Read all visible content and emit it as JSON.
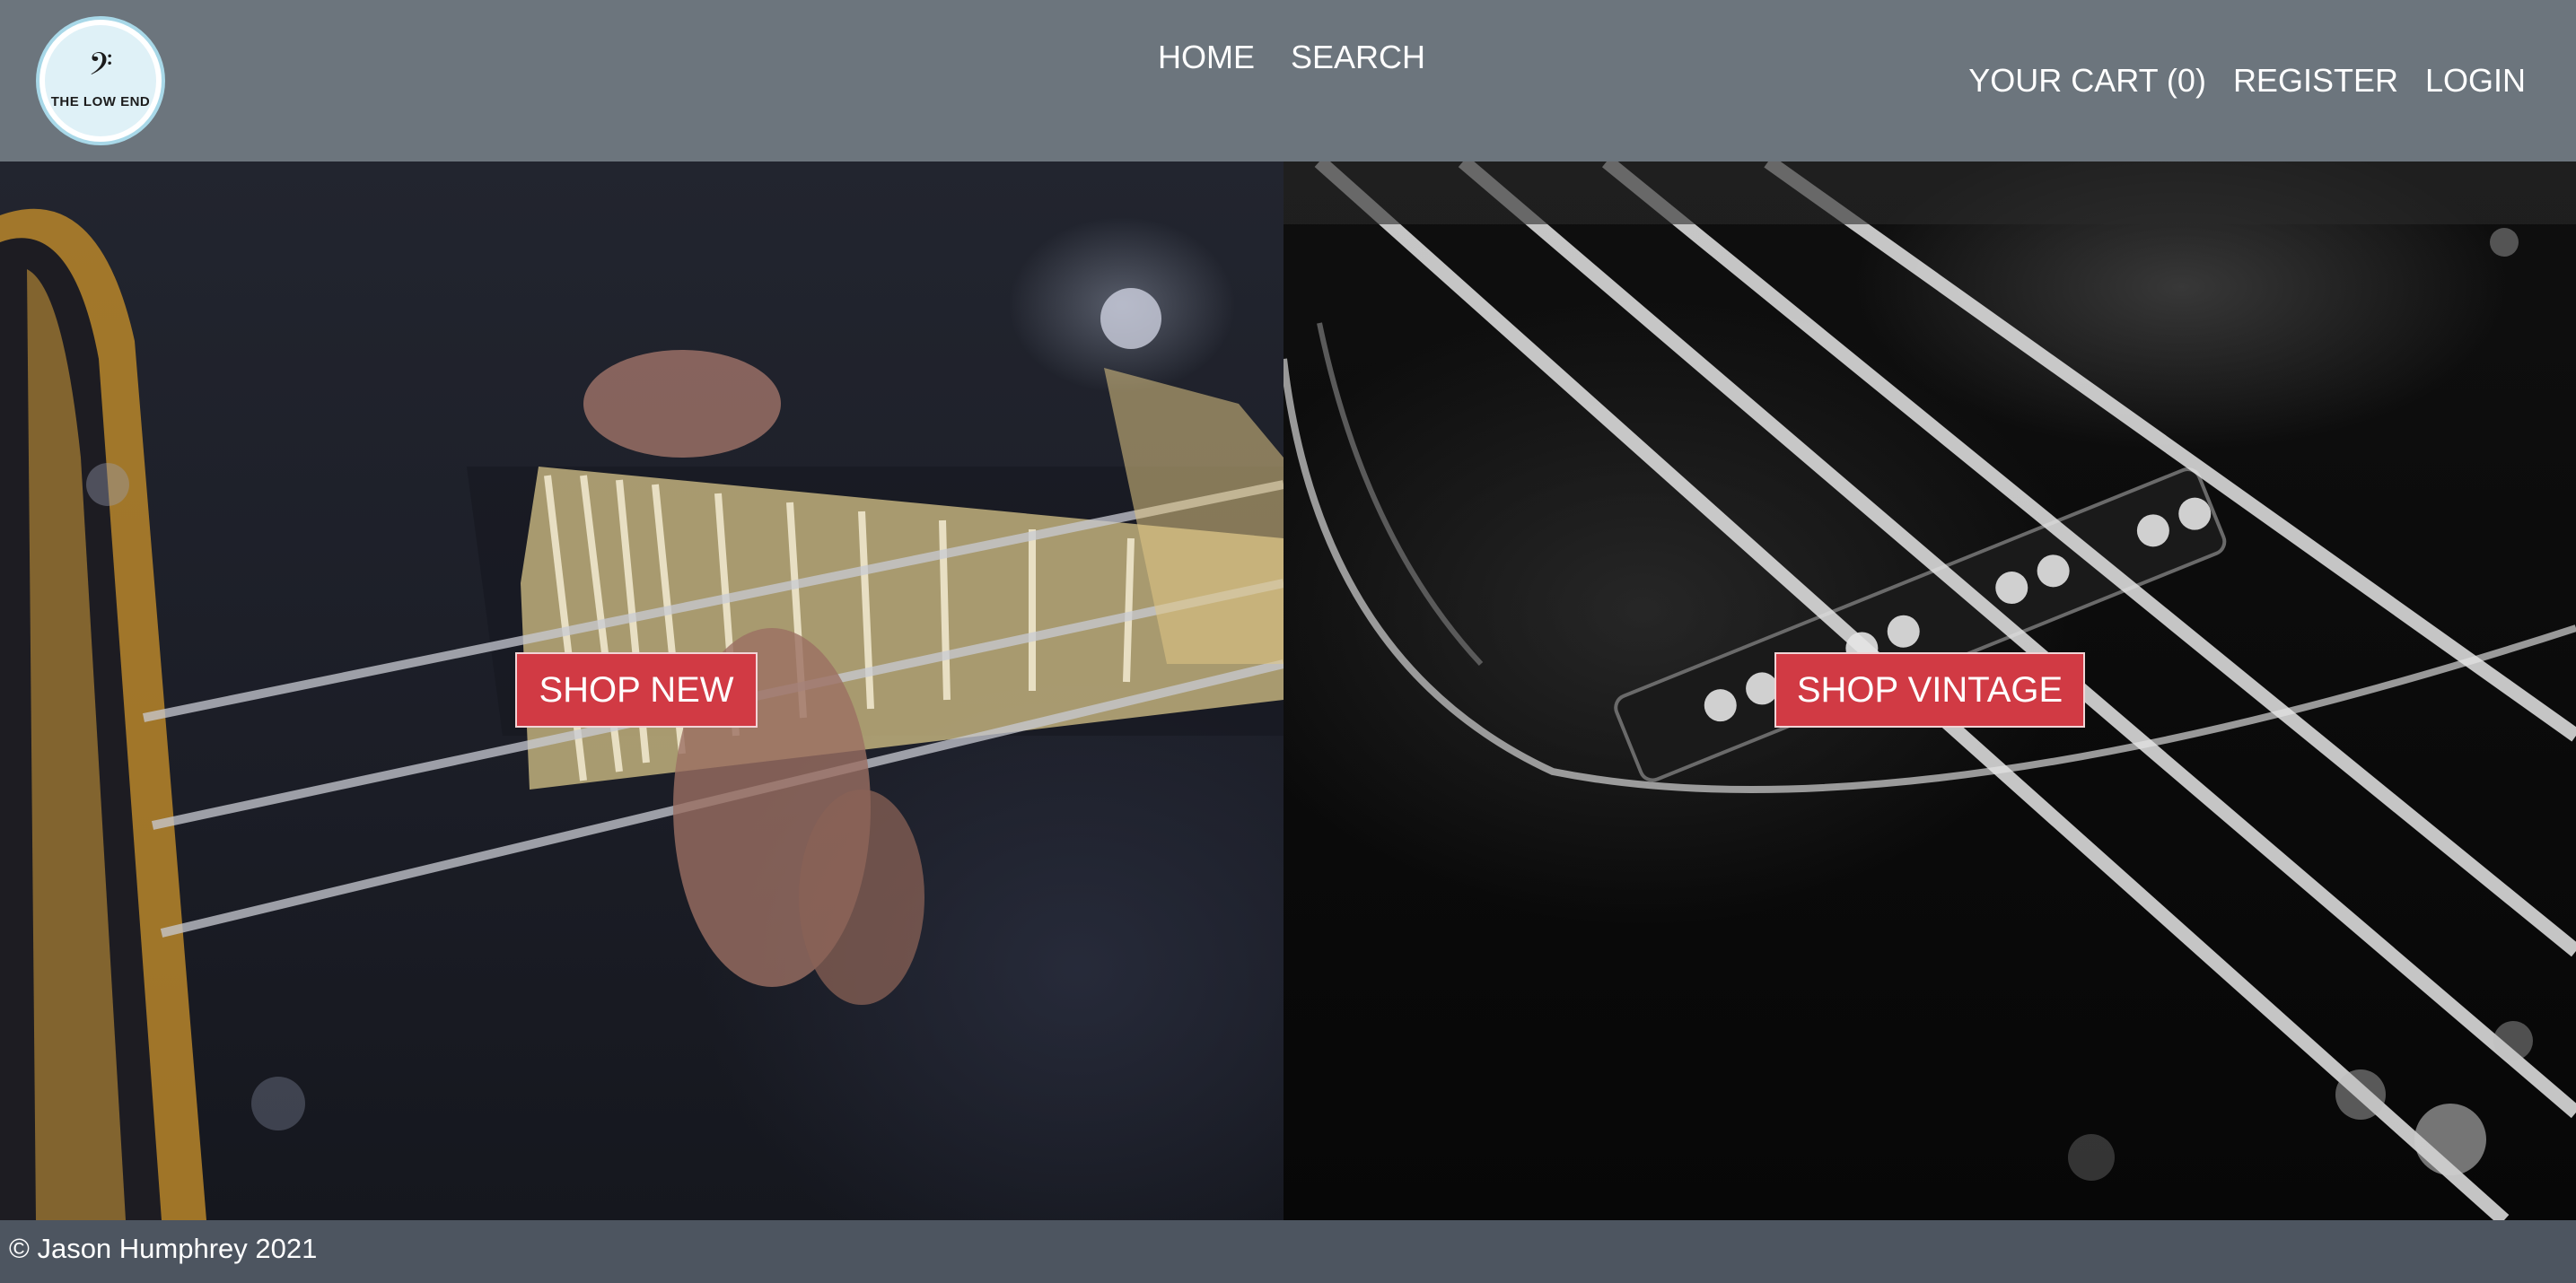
{
  "brand": {
    "logo_glyph": "𝄢",
    "logo_text": "THE LOW END"
  },
  "nav": {
    "home": "HOME",
    "search": "SEARCH",
    "cart": "YOUR CART (0)",
    "register": "REGISTER",
    "login": "LOGIN"
  },
  "hero": {
    "shop_new": "SHOP NEW",
    "shop_vintage": "SHOP VINTAGE"
  },
  "footer": {
    "copyright": "© Jason Humphrey 2021"
  },
  "colors": {
    "header_bg": "#6c757d",
    "footer_bg": "#4d5560",
    "button_bg": "#d13a44",
    "text": "#ffffff"
  }
}
